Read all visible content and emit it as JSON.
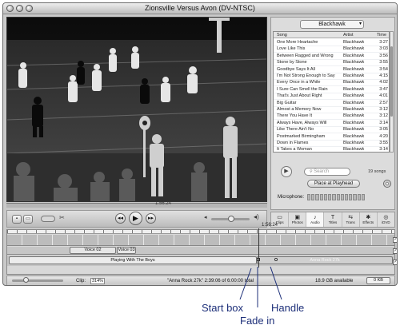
{
  "window": {
    "title": "Zionsville Versus Avon (DV-NTSC)"
  },
  "viewer": {
    "timecode": "1:56:24"
  },
  "music": {
    "source": "Blackhawk",
    "columns": {
      "song": "Song",
      "artist": "Artist",
      "time": "Time"
    },
    "songs": [
      {
        "song": "One More Heartache",
        "artist": "Blackhawk",
        "time": "3:27"
      },
      {
        "song": "Love Like This",
        "artist": "Blackhawk",
        "time": "3:03"
      },
      {
        "song": "Between Ragged and Wrong",
        "artist": "Blackhawk",
        "time": "3:56"
      },
      {
        "song": "Stone by Stone",
        "artist": "Blackhawk",
        "time": "3:55"
      },
      {
        "song": "Goodbye Says It All",
        "artist": "Blackhawk",
        "time": "3:54"
      },
      {
        "song": "I'm Not Strong Enough to Say",
        "artist": "Blackhawk",
        "time": "4:15"
      },
      {
        "song": "Every Once in a While",
        "artist": "Blackhawk",
        "time": "4:02"
      },
      {
        "song": "I Sure Can Smell the Rain",
        "artist": "Blackhawk",
        "time": "3:47"
      },
      {
        "song": "That's Just About Right",
        "artist": "Blackhawk",
        "time": "4:01"
      },
      {
        "song": "Big Guitar",
        "artist": "Blackhawk",
        "time": "2:57"
      },
      {
        "song": "Almost a Memory Now",
        "artist": "Blackhawk",
        "time": "3:12"
      },
      {
        "song": "There You Have It",
        "artist": "Blackhawk",
        "time": "3:12"
      },
      {
        "song": "Always Have, Always Will",
        "artist": "Blackhawk",
        "time": "3:14"
      },
      {
        "song": "Like There Ain't No",
        "artist": "Blackhawk",
        "time": "3:05"
      },
      {
        "song": "Postmarked Birmingham",
        "artist": "Blackhawk",
        "time": "4:20"
      },
      {
        "song": "Down in Flames",
        "artist": "Blackhawk",
        "time": "3:55"
      },
      {
        "song": "It Takes a Woman",
        "artist": "Blackhawk",
        "time": "3:14"
      }
    ],
    "search_placeholder": "Search",
    "song_count": "19 songs",
    "place_button": "Place at Playhead",
    "microphone_label": "Microphone:"
  },
  "tools": [
    {
      "label": "Clips",
      "glyph": "▭"
    },
    {
      "label": "Photos",
      "glyph": "▣"
    },
    {
      "label": "Audio",
      "glyph": "♪"
    },
    {
      "label": "Titles",
      "glyph": "T"
    },
    {
      "label": "Trans",
      "glyph": "⇆"
    },
    {
      "label": "Effects",
      "glyph": "✱"
    },
    {
      "label": "iDVD",
      "glyph": "◎"
    }
  ],
  "timeline": {
    "playhead_timecode": "1:56:24",
    "audio_clips": [
      "Voice 02",
      "Voice 03"
    ],
    "music_clips": [
      "Playing With The Boys",
      "Anna Rock 27k"
    ]
  },
  "status": {
    "clip_label": "Clip:",
    "clip_percent": "314%",
    "clip_info": "\"Anna Rock 27k\" 2:39:06 of 6:00:00 total",
    "disk_available": "18.9 GB available",
    "trash": "0 KB"
  },
  "callouts": {
    "start_box": "Start box",
    "handle": "Handle",
    "fade_in": "Fade in"
  },
  "icons": [
    "close-icon",
    "minimize-icon",
    "zoom-icon",
    "camera-mode-icon",
    "edit-mode-icon",
    "rewind-icon",
    "play-icon",
    "fast-forward-icon",
    "volume-low-icon",
    "volume-high-icon",
    "play-song-icon",
    "search-icon",
    "cd-icon",
    "scissors-icon",
    "trash-icon"
  ]
}
